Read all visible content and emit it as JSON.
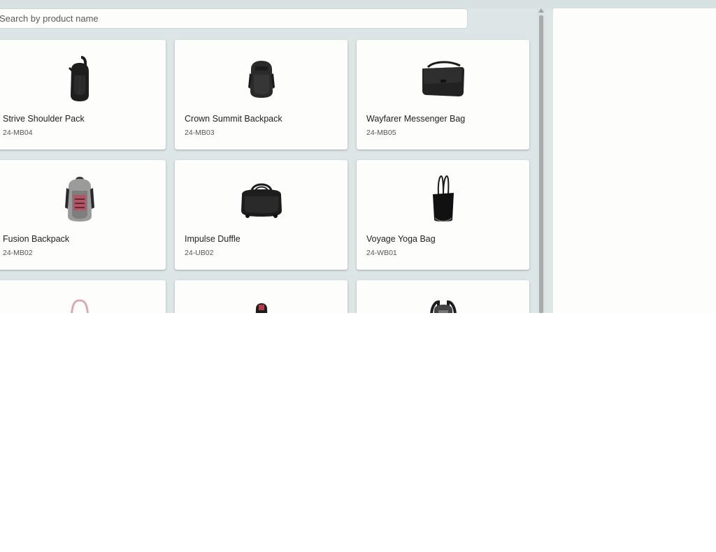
{
  "search": {
    "placeholder": "Search by product name"
  },
  "products": [
    {
      "name": "Strive Shoulder Pack",
      "sku": "24-MB04",
      "icon": "sling-backpack-image"
    },
    {
      "name": "Crown Summit Backpack",
      "sku": "24-MB03",
      "icon": "backpack-image"
    },
    {
      "name": "Wayfarer Messenger Bag",
      "sku": "24-MB05",
      "icon": "messenger-bag-image"
    },
    {
      "name": "Fusion Backpack",
      "sku": "24-MB02",
      "icon": "backpack-image"
    },
    {
      "name": "Impulse Duffle",
      "sku": "24-UB02",
      "icon": "duffle-bag-image"
    },
    {
      "name": "Voyage Yoga Bag",
      "sku": "24-WB01",
      "icon": "tote-bag-image"
    },
    {
      "name": "",
      "sku": "",
      "icon": "pink-bag-image"
    },
    {
      "name": "",
      "sku": "",
      "icon": "backpack-image"
    },
    {
      "name": "",
      "sku": "",
      "icon": "backpack-image"
    }
  ],
  "colors": {
    "background": "#dde6e6",
    "card": "#fdfdfb",
    "text": "#222222",
    "subtext": "#555555"
  }
}
